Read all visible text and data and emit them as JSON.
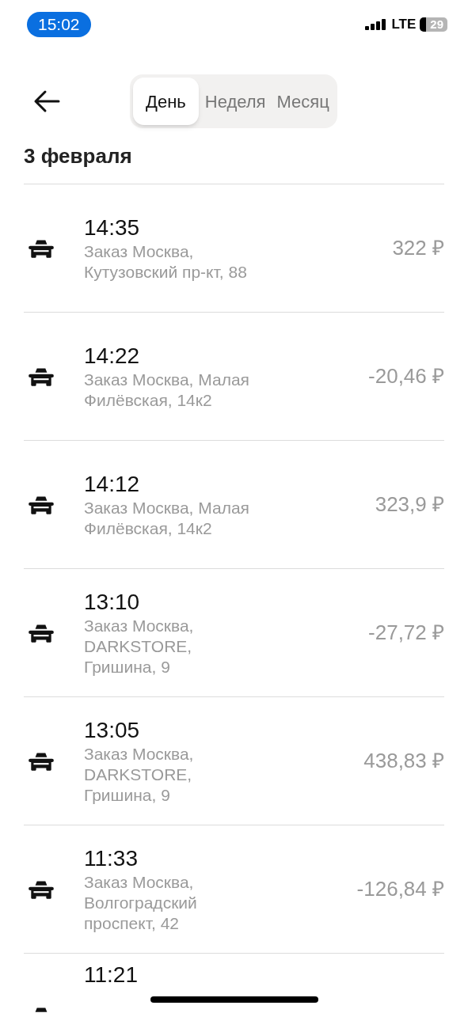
{
  "status_bar": {
    "time": "15:02",
    "network": "LTE",
    "battery": "29"
  },
  "tabs": [
    {
      "label": "День",
      "selected": true
    },
    {
      "label": "Неделя",
      "selected": false
    },
    {
      "label": "Месяц",
      "selected": false
    }
  ],
  "date_heading": "3 февраля",
  "orders": [
    {
      "time": "14:35",
      "address": "Заказ Москва, Кутузовский пр-кт, 88",
      "amount": "322 ₽"
    },
    {
      "time": "14:22",
      "address": "Заказ Москва, Малая Филёвская, 14к2",
      "amount": "-20,46 ₽"
    },
    {
      "time": "14:12",
      "address": "Заказ Москва, Малая Филёвская, 14к2",
      "amount": "323,9 ₽"
    },
    {
      "time": "13:10",
      "address": "Заказ Москва, DARKSTORE, Гришина, 9",
      "amount": "-27,72 ₽"
    },
    {
      "time": "13:05",
      "address": "Заказ Москва, DARKSTORE, Гришина, 9",
      "amount": "438,83 ₽"
    },
    {
      "time": "11:33",
      "address": "Заказ Москва, Волгоградский проспект, 42",
      "amount": "-126,84 ₽"
    },
    {
      "time": "11:21"
    }
  ]
}
